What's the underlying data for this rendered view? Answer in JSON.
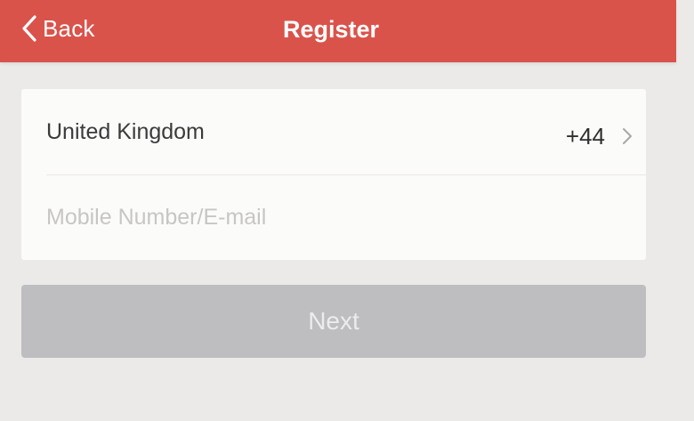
{
  "header": {
    "back_label": "Back",
    "title": "Register",
    "back_icon": "chevron-left-icon",
    "background_color": "#d9534b"
  },
  "form": {
    "country_name": "United Kingdom",
    "country_code": "+44",
    "country_chevron_icon": "chevron-right-icon",
    "mobile_value": "",
    "mobile_placeholder": "Mobile Number/E-mail"
  },
  "actions": {
    "next_label": "Next",
    "next_color": "#bebdbf"
  }
}
